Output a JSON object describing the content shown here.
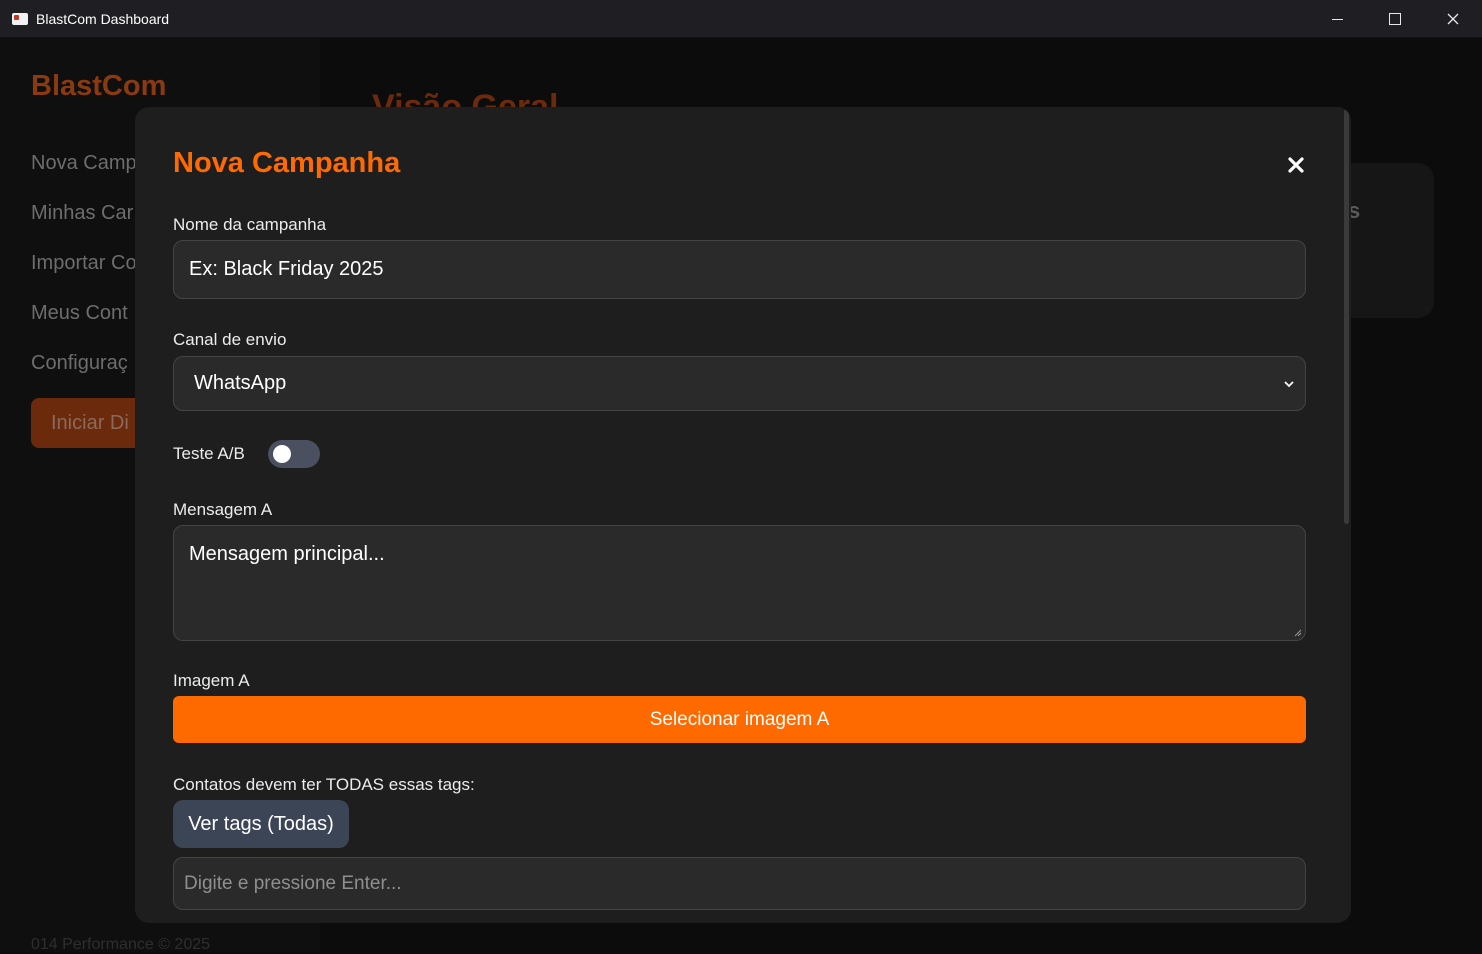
{
  "window": {
    "title": "BlastCom Dashboard",
    "icons": {
      "app": "app-logo-icon",
      "minimize": "minimize-icon",
      "maximize": "maximize-icon",
      "close": "close-icon"
    }
  },
  "background": {
    "brand": "BlastCom",
    "nav": [
      "Nova Camp",
      "Minhas Car",
      "Importar Co",
      "Meus Cont",
      "Configuraç"
    ],
    "start_button": "Iniciar Di",
    "main_title": "Visão Geral",
    "card_letter": "s",
    "footer": "014 Performance © 2025"
  },
  "modal": {
    "title": "Nova Campanha",
    "close_icon": "close-x-icon",
    "campaign_name": {
      "label": "Nome da campanha",
      "placeholder": "Ex: Black Friday 2025"
    },
    "channel": {
      "label": "Canal de envio",
      "selected": "WhatsApp",
      "icon": "chevron-down-icon"
    },
    "ab_test": {
      "label": "Teste A/B",
      "enabled": false
    },
    "message_a": {
      "label": "Mensagem A",
      "placeholder": "Mensagem principal..."
    },
    "image_a": {
      "label": "Imagem A",
      "button": "Selecionar imagem A"
    },
    "tags": {
      "label": "Contatos devem ter TODAS essas tags:",
      "button": "Ver tags (Todas)",
      "placeholder": "Digite e pressione Enter..."
    }
  },
  "colors": {
    "accent": "#ff6a00",
    "modal_bg": "#1e1e1e",
    "field_bg": "#2a2a2a",
    "tag_button": "#3c4556"
  }
}
